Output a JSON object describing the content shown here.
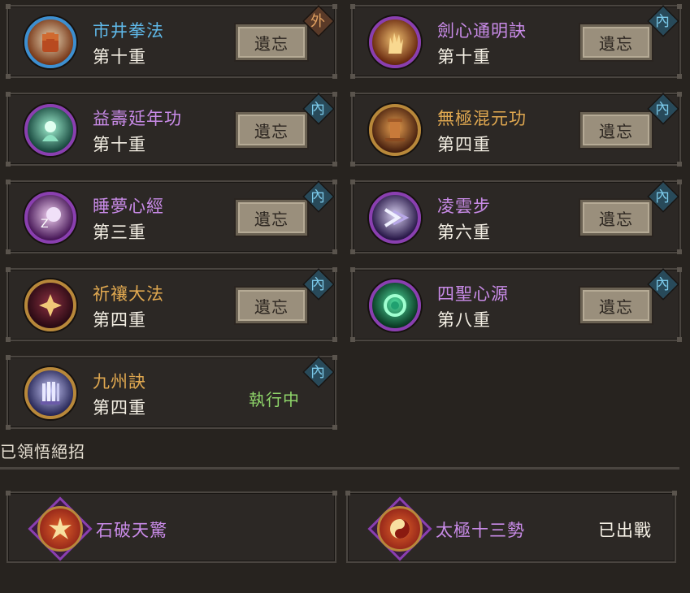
{
  "skills": [
    {
      "name": "市井拳法",
      "level": "第十重",
      "type": "外",
      "action": "遺忘",
      "name_color": "#5fb8e8",
      "icon": "fist-icon"
    },
    {
      "name": "劍心通明訣",
      "level": "第十重",
      "type": "內",
      "action": "遺忘",
      "name_color": "#c98be8",
      "icon": "flame-hand-icon"
    },
    {
      "name": "益壽延年功",
      "level": "第十重",
      "type": "內",
      "action": "遺忘",
      "name_color": "#c98be8",
      "icon": "spirit-icon"
    },
    {
      "name": "無極混元功",
      "level": "第四重",
      "type": "內",
      "action": "遺忘",
      "name_color": "#e0a850",
      "icon": "pillar-icon"
    },
    {
      "name": "睡夢心經",
      "level": "第三重",
      "type": "內",
      "action": "遺忘",
      "name_color": "#c98be8",
      "icon": "sleep-icon"
    },
    {
      "name": "凌雲步",
      "level": "第六重",
      "type": "內",
      "action": "遺忘",
      "name_color": "#c98be8",
      "icon": "wind-step-icon"
    },
    {
      "name": "祈禳大法",
      "level": "第四重",
      "type": "內",
      "action": "遺忘",
      "name_color": "#e0a850",
      "icon": "sigil-icon"
    },
    {
      "name": "四聖心源",
      "level": "第八重",
      "type": "內",
      "action": "遺忘",
      "name_color": "#c98be8",
      "icon": "vortex-icon"
    },
    {
      "name": "九州訣",
      "level": "第四重",
      "type": "內",
      "status": "執行中",
      "name_color": "#e0a850",
      "icon": "waterfall-icon"
    }
  ],
  "ultimates_section": {
    "title": "已領悟絕招"
  },
  "ultimates": [
    {
      "name": "石破天驚",
      "icon": "burst-icon"
    },
    {
      "name": "太極十三勢",
      "status": "已出戰",
      "icon": "taiji-icon"
    }
  ]
}
